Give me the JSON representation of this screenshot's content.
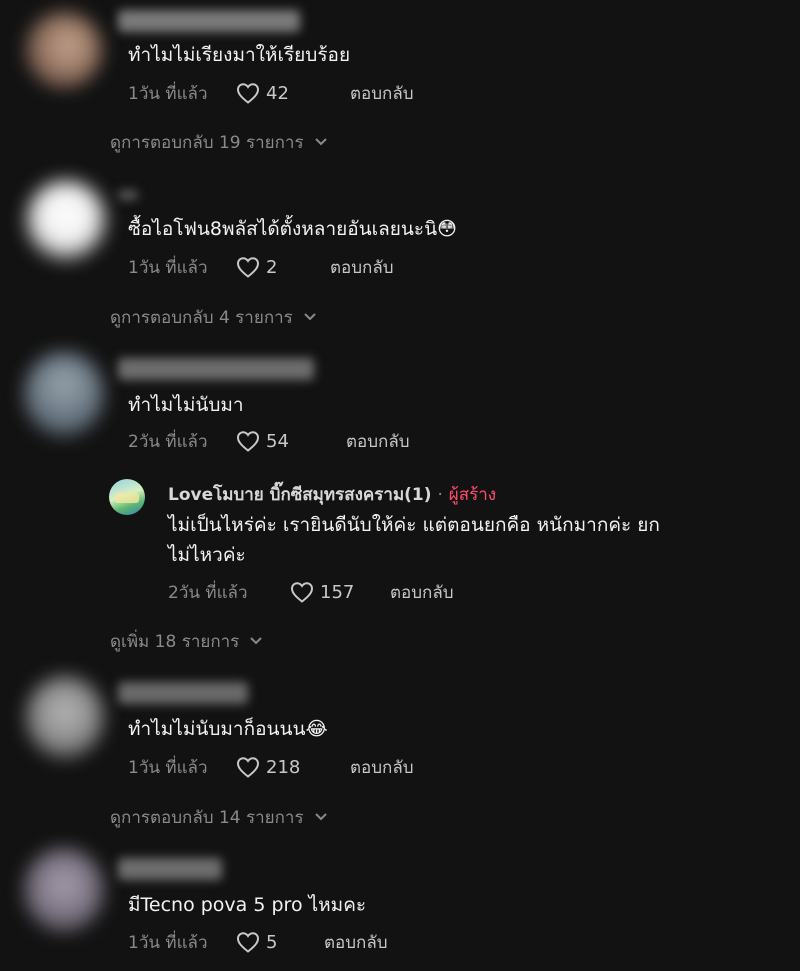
{
  "colors": {
    "background": "#121212",
    "creator_badge": "#ff4d6d"
  },
  "comments": [
    {
      "text": "ทำไมไม่เรียงมาให้เรียบร้อย",
      "time": "1วัน ที่แล้ว",
      "likes": "42",
      "reply_label": "ตอบกลับ",
      "view_replies": "ดูการตอบกลับ 19 รายการ"
    },
    {
      "text": "ซื้อไอโฟน8พลัสได้ตั้งหลายอันเลยนะนิ😳",
      "time": "1วัน ที่แล้ว",
      "likes": "2",
      "reply_label": "ตอบกลับ",
      "view_replies": "ดูการตอบกลับ 4 รายการ"
    },
    {
      "text": "ทำไมไม่นับมา",
      "time": "2วัน ที่แล้ว",
      "likes": "54",
      "reply_label": "ตอบกลับ",
      "reply": {
        "author": "Loveโมบาย บิ๊กซีสมุทรสงคราม(1)",
        "separator": "·",
        "badge": "ผู้สร้าง",
        "text_line1": "ไม่เป็นไหร่ค่ะ เรายินดีนับให้ค่ะ แต่ตอนยกคือ หนักมากค่ะ ยก",
        "text_line2": "ไม่ไหวค่ะ",
        "time": "2วัน ที่แล้ว",
        "likes": "157",
        "reply_label": "ตอบกลับ"
      },
      "view_more": "ดูเพิ่ม 18 รายการ"
    },
    {
      "text": "ทำไมไม่นับมาก็อนนน😂",
      "time": "1วัน ที่แล้ว",
      "likes": "218",
      "reply_label": "ตอบกลับ",
      "view_replies": "ดูการตอบกลับ 14 รายการ"
    },
    {
      "text": "มีTecno pova 5 pro ไหมคะ",
      "time": "1วัน ที่แล้ว",
      "likes": "5",
      "reply_label": "ตอบกลับ"
    }
  ]
}
